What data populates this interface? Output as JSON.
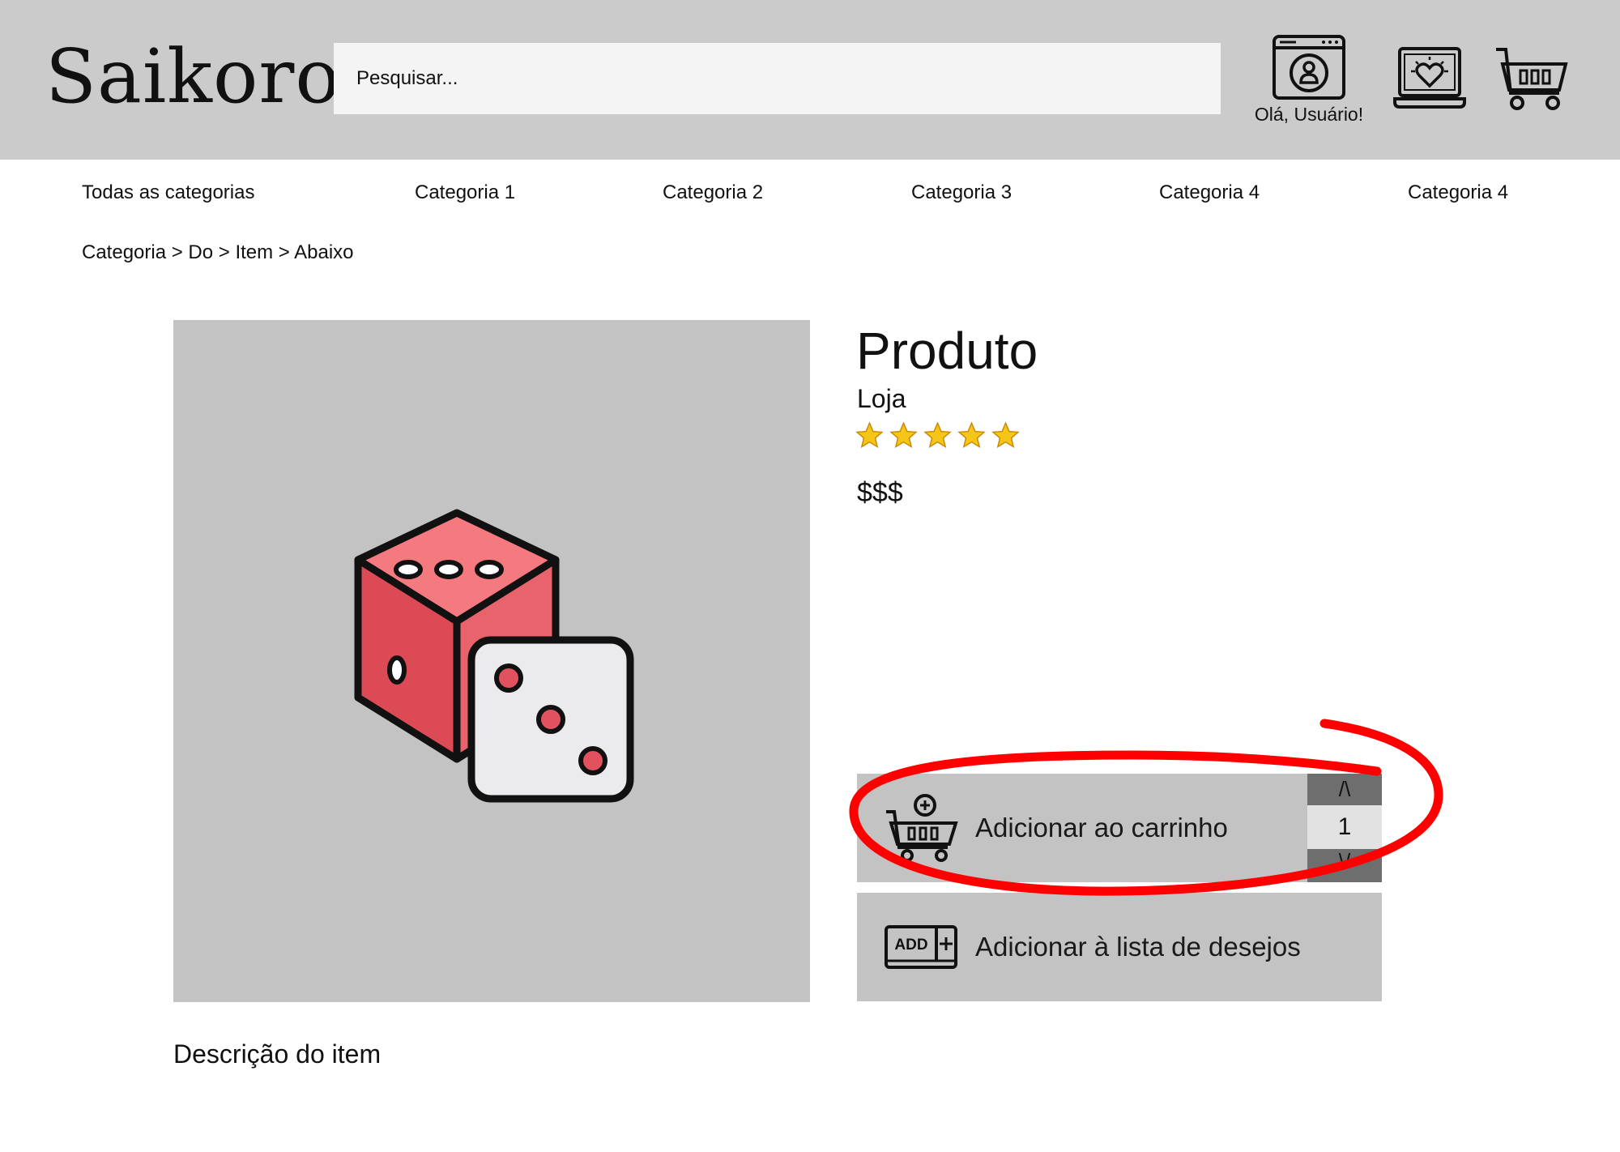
{
  "header": {
    "logo": "Saikoro",
    "search_placeholder": "Pesquisar...",
    "user_greeting": "Olá, Usuário!",
    "icons": [
      "user-account-icon",
      "wishlist-laptop-heart-icon",
      "cart-icon"
    ]
  },
  "categories": [
    "Todas as categorias",
    "Categoria 1",
    "Categoria 2",
    "Categoria 3",
    "Categoria 4",
    "Categoria 4"
  ],
  "breadcrumb": "Categoria > Do > Item > Abaixo",
  "product": {
    "title": "Produto",
    "store": "Loja",
    "rating": 5,
    "rating_max": 5,
    "price": "$$$",
    "image_icon": "dice-icon",
    "description": "Descrição do item"
  },
  "actions": {
    "add_to_cart": "Adicionar ao carrinho",
    "add_to_wishlist": "Adicionar à lista de desejos",
    "quantity": "1",
    "qty_up": "/\\",
    "qty_down": "\\/",
    "wishlist_badge": "ADD"
  },
  "colors": {
    "header_bg": "#cbcbcb",
    "panel_bg": "#c3c3c3",
    "annotation": "#ff0000",
    "dice_red": "#e2525e",
    "star": "#f5c518"
  }
}
